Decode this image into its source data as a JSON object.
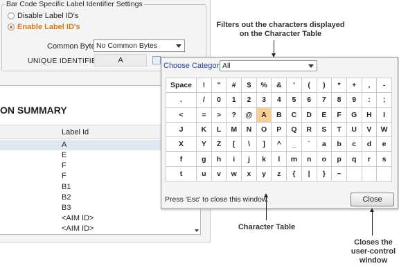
{
  "settings": {
    "legend": "Bar Code Specific Label Identifier Settings",
    "radio_disable": "Disable Label ID's",
    "radio_enable": "Enable Label ID's",
    "common_byte_label": "Common Byte",
    "common_byte_value": "No Common Bytes",
    "unique_identifier_label": "UNIQUE IDENTIFIER",
    "unique_identifier_value": "A"
  },
  "summary": {
    "title": "ON SUMMARY",
    "column_header": "Label Id",
    "rows": [
      "A",
      "E",
      "F",
      "F",
      "B1",
      "B2",
      "B3",
      "<AIM ID>",
      "<AIM ID>"
    ]
  },
  "popup": {
    "category_label": "Choose Category",
    "category_value": "All",
    "rows": [
      [
        "Space",
        "!",
        "\"",
        "#",
        "$",
        "%",
        "&",
        "'",
        "(",
        ")",
        "*",
        "+",
        ",",
        "-"
      ],
      [
        ".",
        "/",
        "0",
        "1",
        "2",
        "3",
        "4",
        "5",
        "6",
        "7",
        "8",
        "9",
        ":",
        ";"
      ],
      [
        "<",
        "=",
        ">",
        "?",
        "@",
        "A",
        "B",
        "C",
        "D",
        "E",
        "F",
        "G",
        "H",
        "I"
      ],
      [
        "J",
        "K",
        "L",
        "M",
        "N",
        "O",
        "P",
        "Q",
        "R",
        "S",
        "T",
        "U",
        "V",
        "W"
      ],
      [
        "X",
        "Y",
        "Z",
        "[",
        "\\",
        "]",
        "^",
        "_",
        "`",
        "a",
        "b",
        "c",
        "d",
        "e"
      ],
      [
        "f",
        "g",
        "h",
        "i",
        "j",
        "k",
        "l",
        "m",
        "n",
        "o",
        "p",
        "q",
        "r",
        "s"
      ],
      [
        "t",
        "u",
        "v",
        "w",
        "x",
        "y",
        "z",
        "{",
        "|",
        "}",
        "~",
        "",
        "",
        ""
      ]
    ],
    "highlighted_char": "A",
    "esc_hint": "Press 'Esc' to close this window.",
    "close_label": "Close"
  },
  "callouts": {
    "filters": [
      "Filters out the characters displayed",
      "on the Character Table"
    ],
    "character_table": "Character Table",
    "closes": [
      "Closes the",
      "user-control",
      "window"
    ]
  }
}
